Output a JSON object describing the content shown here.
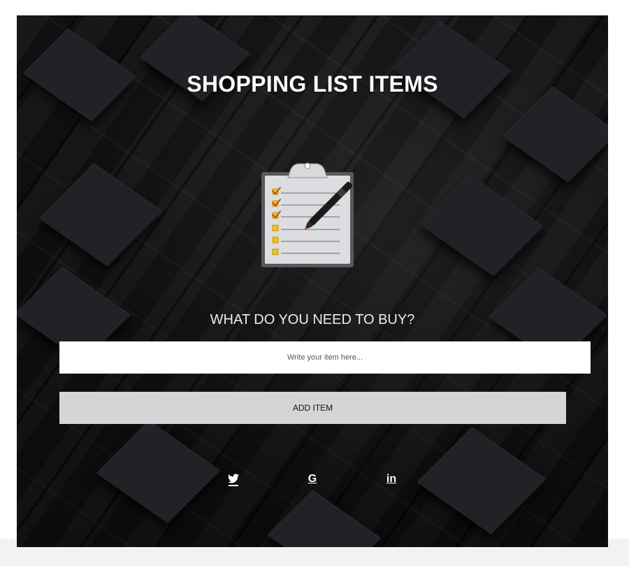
{
  "header": {
    "title": "SHOPPING LIST ITEMS"
  },
  "illustration": {
    "icon": "clipboard-checklist-pen-icon"
  },
  "form": {
    "prompt": "WHAT DO YOU NEED TO BUY?",
    "input_placeholder": "Write your item here...",
    "input_value": "",
    "add_button_label": "ADD ITEM"
  },
  "social": [
    {
      "name": "twitter",
      "icon": "twitter-icon"
    },
    {
      "name": "google",
      "icon": "google-icon",
      "glyph": "G"
    },
    {
      "name": "linkedin",
      "icon": "linkedin-icon",
      "glyph": "in"
    }
  ],
  "colors": {
    "background": "#151517",
    "title_text": "#ffffff",
    "button_bg": "#d6d4d6",
    "input_bg": "#ffffff",
    "checkbox_yellow": "#f4c20d"
  }
}
